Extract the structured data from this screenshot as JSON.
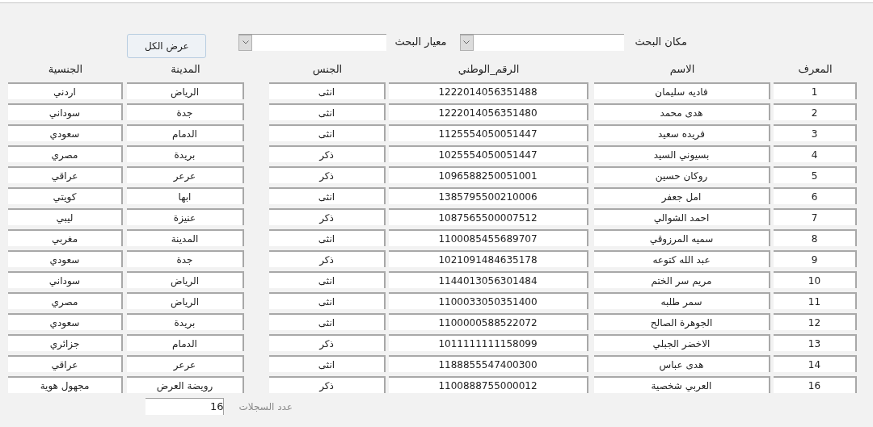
{
  "search": {
    "place_label": "مكان البحث",
    "criteria_label": "معيار البحث",
    "show_all_button": "عرض الكل"
  },
  "table": {
    "columns": [
      "المعرف",
      "الاسم",
      "الرقم_الوطني",
      "الجنس",
      "المدينة",
      "الجنسية"
    ],
    "rows": [
      [
        "1",
        "فاديه سليمان",
        "1222014056351488",
        "انثى",
        "الرياض",
        "اردني"
      ],
      [
        "2",
        "هدى محمد",
        "1222014056351480",
        "انثى",
        "جدة",
        "سوداني"
      ],
      [
        "3",
        "فريده سعيد",
        "1125554050051447",
        "انثى",
        "الدمام",
        "سعودي"
      ],
      [
        "4",
        "بسيوني السيد",
        "1025554050051447",
        "ذكر",
        "بريدة",
        "مصري"
      ],
      [
        "5",
        "روكان حسين",
        "1096588250051001",
        "ذكر",
        "عرعر",
        "عراقي"
      ],
      [
        "6",
        "امل جعفر",
        "1385795500210006",
        "انثى",
        "ابها",
        "كويتي"
      ],
      [
        "7",
        "احمد الشوالي",
        "1087565500007512",
        "ذكر",
        "عنيزة",
        "ليبي"
      ],
      [
        "8",
        "سميه المرزوقي",
        "1100085455689707",
        "انثى",
        "المدينة",
        "مغربي"
      ],
      [
        "9",
        "عبد الله كتوعه",
        "1021091484635178",
        "ذكر",
        "جدة",
        "سعودي"
      ],
      [
        "10",
        "مريم سر الختم",
        "1144013056301484",
        "انثى",
        "الرياض",
        "سوداني"
      ],
      [
        "11",
        "سمر  طلبه",
        "1100033050351400",
        "انثى",
        "الرياض",
        "مصري"
      ],
      [
        "12",
        "الجوهرة الصالح",
        "1100000588522072",
        "انثى",
        "بريدة",
        "سعودي"
      ],
      [
        "13",
        "الاخضر الجبلي",
        "1011111111158099",
        "ذكر",
        "الدمام",
        "جزائري"
      ],
      [
        "14",
        "هدى عباس",
        "1188855547400300",
        "انثى",
        "عرعر",
        "عراقي"
      ],
      [
        "16",
        "العربي شخصية",
        "1100888755000012",
        "ذكر",
        "رويضة العرض",
        "مجهول هوية"
      ]
    ]
  },
  "footer": {
    "count_label": "عدد السجلات",
    "count_value": "16"
  }
}
